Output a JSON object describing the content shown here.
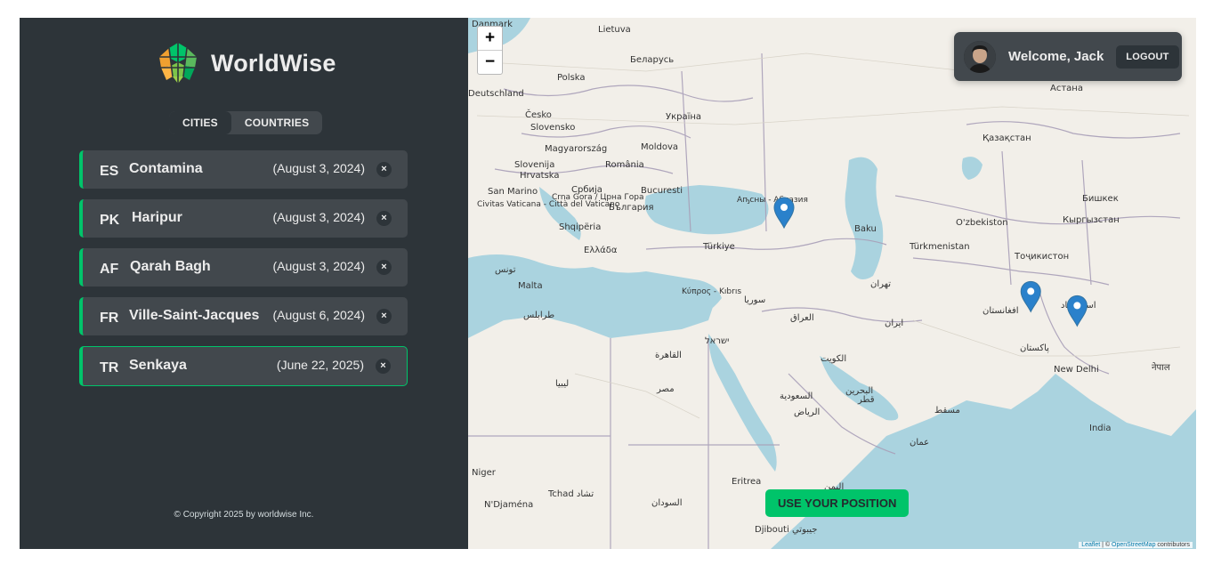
{
  "app": {
    "name": "WorldWise"
  },
  "nav": {
    "tabs": [
      {
        "label": "Cities",
        "active": true
      },
      {
        "label": "Countries",
        "active": false
      }
    ]
  },
  "cities": [
    {
      "code": "ES",
      "name": "Contamina",
      "date": "(August 3, 2024)"
    },
    {
      "code": "PK",
      "name": "Haripur",
      "date": "(August 3, 2024)"
    },
    {
      "code": "AF",
      "name": "Qarah Bagh",
      "date": "(August 3, 2024)"
    },
    {
      "code": "FR",
      "name": "Ville-Saint-Jacques",
      "date": "(August 6, 2024)"
    },
    {
      "code": "TR",
      "name": "Senkaya",
      "date": "(June 22, 2025)",
      "selected": true
    }
  ],
  "delete_glyph": "×",
  "footer": {
    "copyright": "© Copyright 2025 by worldwise Inc."
  },
  "map": {
    "zoom_in": "+",
    "zoom_out": "−",
    "user": {
      "welcome": "Welcome, Jack",
      "logout": "Logout"
    },
    "use_position": "USE YOUR POSITION",
    "attribution": {
      "leaflet": "Leaflet",
      "sep": " | © ",
      "osm": "OpenStreetMap",
      "tail": " contributors"
    },
    "labels": [
      "Danmark",
      "Lietuva",
      "Беларусь",
      "Polska",
      "Deutschland",
      "Česko",
      "Україна",
      "Slovensko",
      "Magyarország",
      "Moldova",
      "Slovenija",
      "Hrvatska",
      "România",
      "San Marino",
      "Civitas Vaticana - Città del Vaticano",
      "Србија",
      "Crna Gora / Црна Гора",
      "България",
      "Bucuresti",
      "Shqipëria",
      "Ελλάδα",
      "Türkiye",
      "Malta",
      "Κύπρος - Kıbrıs",
      "سوريا",
      "ليبيا",
      "مصر",
      "القاهرة",
      "ישראל",
      "العراق",
      "السعودية",
      "الرياض",
      "الكويت",
      "البحرين",
      "قطر",
      "مسقط",
      "عمان",
      "ایران",
      "تهران",
      "Baku",
      "Türkmenistan",
      "O'zbekiston",
      "Тоҷикистон",
      "Кыргызстан",
      "Бишкек",
      "Қазақстан",
      "Астана",
      "افغانستان",
      "پاکستان",
      "اسلام آباد",
      "New Delhi",
      "नेपाल",
      "India",
      "Niger",
      "N'Djaména",
      "Tchad تشاد",
      "السودان",
      "Eritrea",
      "Djibouti جيبوتي",
      "اليمن",
      "تونس",
      "طرابلس",
      "Аҧсны - Абхазия"
    ],
    "pins": [
      {
        "name": "Senkaya",
        "lat": 40.56,
        "lon": 42.35
      },
      {
        "name": "Qarah Bagh",
        "lat": 34.94,
        "lon": 68.09
      },
      {
        "name": "Haripur",
        "lat": 33.99,
        "lon": 72.93
      }
    ]
  }
}
